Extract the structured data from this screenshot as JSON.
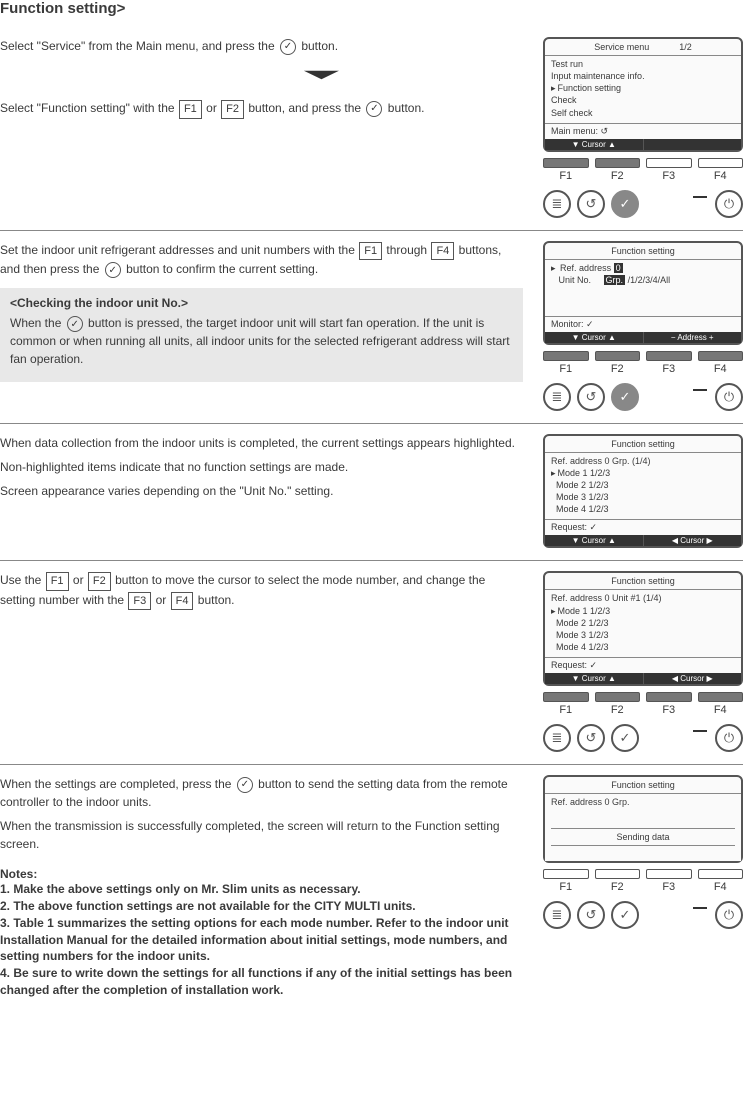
{
  "heading": "Function setting>",
  "sec1": {
    "p1a": "Select \"Service\" from the Main menu, and press the ",
    "p1b": " button.",
    "p2a": "Select \"Function setting\" with the ",
    "key1": "F1",
    "p2b": " or ",
    "key2": "F2",
    "p2c": " button, and press the ",
    "p2d": " button.",
    "lcd": {
      "title": "Service menu",
      "page": "1/2",
      "r1": "Test run",
      "r2": "Input maintenance info.",
      "r3": "Function setting",
      "r4": "Check",
      "r5": "Self check",
      "f1": "Main menu: ↺",
      "bb1": "▼ Cursor ▲"
    }
  },
  "sec2": {
    "p1a": "Set the indoor unit refrigerant addresses and unit numbers with the ",
    "key1": "F1",
    "p1b": " through ",
    "key2": "F4",
    "p1c": " buttons, and then press the ",
    "p1d": " button to confirm the current setting.",
    "boxTitle": "<Checking the indoor unit No.>",
    "box1": "When the ",
    "box2": " button is pressed, the target indoor unit will start fan operation. If the unit is common or when running all units, all indoor units for the selected refrigerant address will start fan operation.",
    "lcd": {
      "title": "Function setting",
      "r1a": "Ref. address ",
      "r1v": " 0 ",
      "r2a": "Unit No.",
      "r2v": "Grp.",
      "r2b": "/1/2/3/4/All",
      "f1": "Monitor: ✓",
      "bb1": "▼ Cursor ▲",
      "bb2": "− Address +"
    }
  },
  "sec3": {
    "p1": "When data collection from the indoor units is completed, the current settings appears highlighted.",
    "p2": "Non-highlighted items indicate that no function settings are made.",
    "p3": "Screen appearance varies depending on the \"Unit No.\" setting.",
    "lcd": {
      "title": "Function setting",
      "r0": "Ref. address    0   Grp.     (1/4)",
      "r1": "Mode 1   1/2/3",
      "r2": "Mode 2   1/2/3",
      "r3": "Mode 3   1/2/3",
      "r4": "Mode 4   1/2/3",
      "f1": "Request: ✓",
      "bb1": "▼ Cursor ▲",
      "bb2": "◀ Cursor ▶"
    }
  },
  "sec4": {
    "p1a": "Use the ",
    "key1": "F1",
    "p1b": " or ",
    "key2": "F2",
    "p1c": " button to move the cursor to select the mode number, and change the setting number with the ",
    "key3": "F3",
    "p1d": " or ",
    "key4": "F4",
    "p1e": " button.",
    "lcd": {
      "title": "Function setting",
      "r0": "Ref. address    0   Unit #1 (1/4)",
      "r1": "Mode 1   1/2/3",
      "r2": "Mode 2   1/2/3",
      "r3": "Mode 3   1/2/3",
      "r4": "Mode 4   1/2/3",
      "f1": "Request: ✓",
      "bb1": "▼ Cursor ▲",
      "bb2": "◀ Cursor ▶"
    }
  },
  "sec5": {
    "p1a": "When the settings are completed, press the ",
    "p1b": " button to send the setting data from the remote controller to the indoor units.",
    "p2": "When the transmission is successfully completed, the screen will return to the Function setting screen.",
    "notesTitle": "Notes:",
    "n1": "1. Make the above settings only on Mr. Slim units as necessary.",
    "n2": "2. The above function settings are not available for the CITY MULTI units.",
    "n3": "3. Table 1 summarizes the setting options for each mode number. Refer to the indoor unit Installation Manual for the detailed information about initial settings, mode numbers, and setting numbers for the indoor units.",
    "n4": "4. Be sure to write down the settings for all functions if any of the initial settings has been changed after the completion of installation work.",
    "lcd": {
      "title": "Function setting",
      "r0": "Ref. address   0   Grp.",
      "msg": "Sending data"
    }
  },
  "fkeys": {
    "f1": "F1",
    "f2": "F2",
    "f3": "F3",
    "f4": "F4"
  }
}
